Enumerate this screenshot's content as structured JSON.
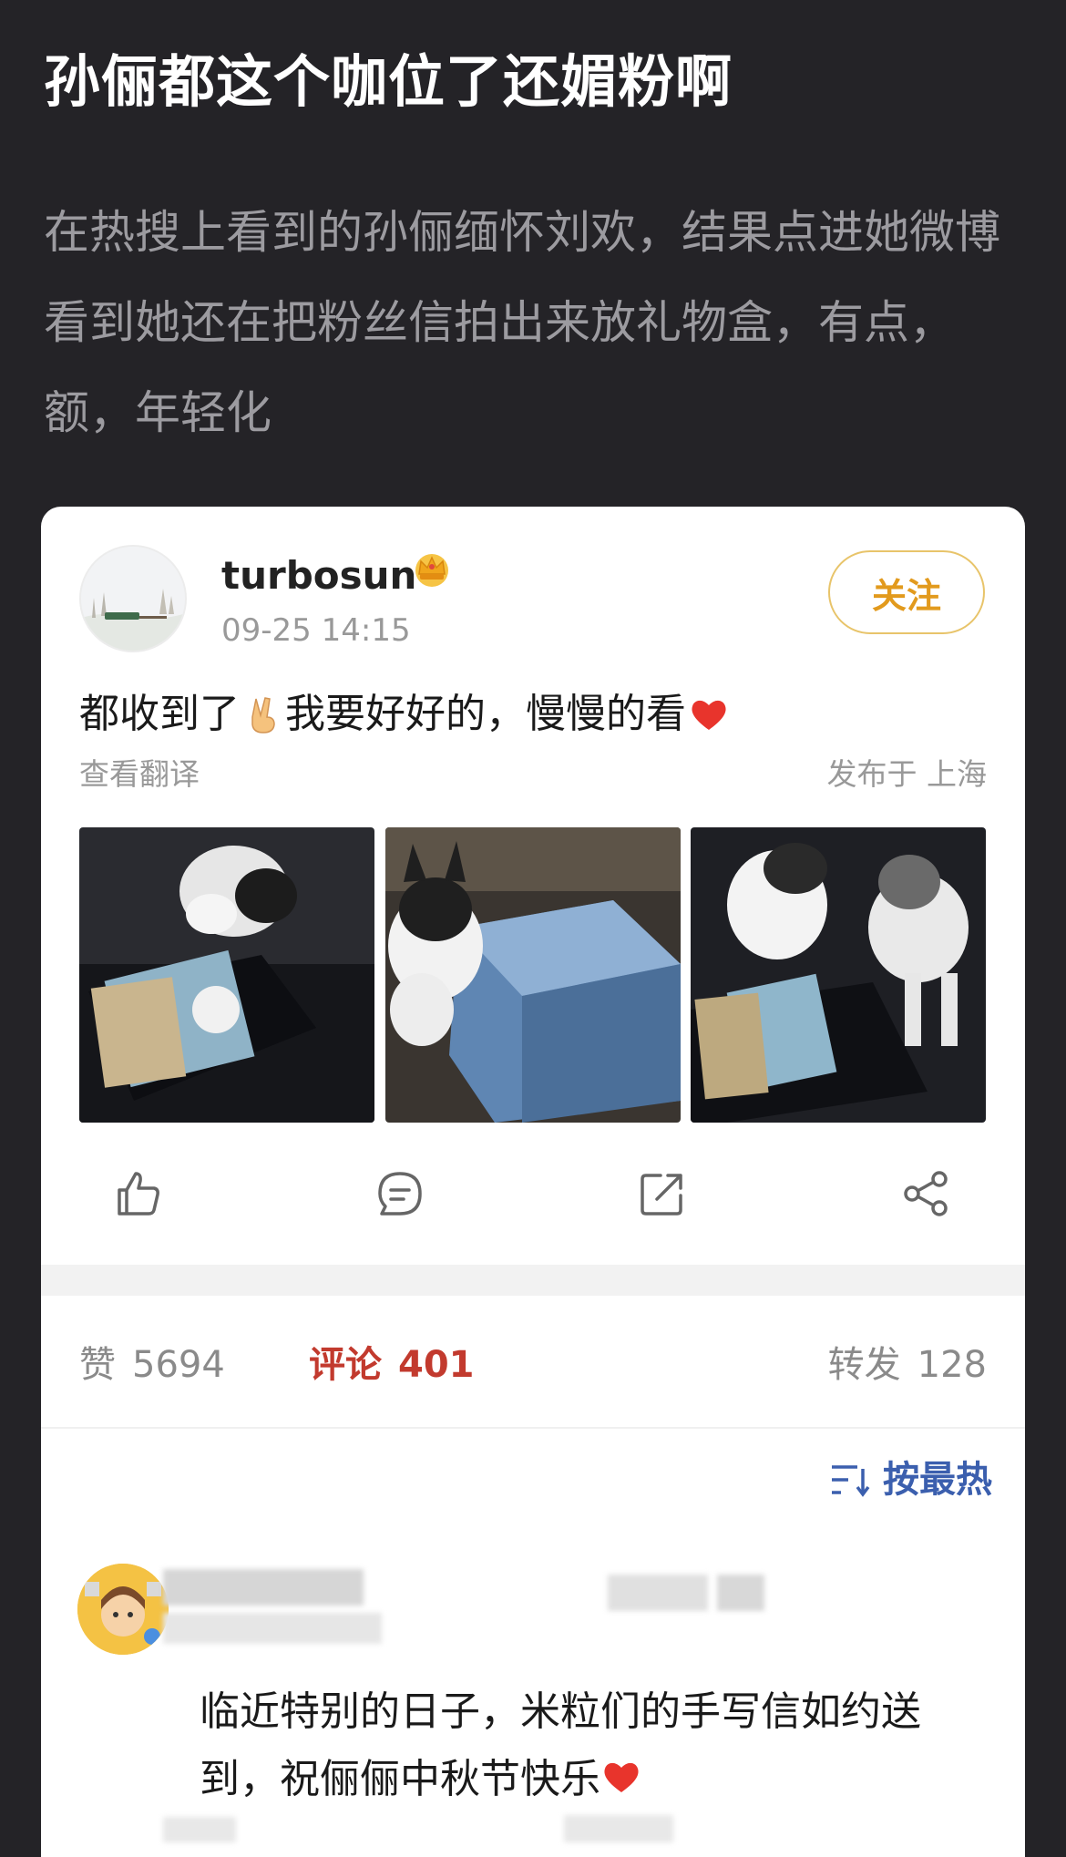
{
  "post": {
    "title": "孙俪都这个咖位了还媚粉啊",
    "description": "在热搜上看到的孙俪缅怀刘欢，结果点进她微博看到她还在把粉丝信拍出来放礼物盒，有点，额，年轻化"
  },
  "weibo": {
    "username": "turbosun",
    "badge_icon": "crown-icon",
    "time": "09-25 14:15",
    "follow_label": "关注",
    "text_part1": "都收到了",
    "text_part2": "我要好好的，慢慢的看",
    "emoji_1": "victory-hand-icon",
    "emoji_2": "red-heart-icon",
    "translate_label": "查看翻译",
    "location": "发布于 上海",
    "photos": [
      "cat-with-letters-photo",
      "cat-and-gift-box-photo",
      "two-cats-with-box-photo"
    ],
    "actions": [
      "like-icon",
      "comment-icon",
      "repost-icon",
      "share-icon"
    ]
  },
  "stats": {
    "like_label": "赞",
    "like_count": "5694",
    "comment_label": "评论",
    "comment_count": "401",
    "repost_label": "转发",
    "repost_count": "128"
  },
  "sort": {
    "label": "按最热"
  },
  "comment": {
    "text_line": "临近特别的日子，米粒们的手写信如约送到，祝俪俪中秋节快乐",
    "emoji": "red-heart-icon"
  },
  "colors": {
    "background": "#242327",
    "card": "#ffffff",
    "accent_comment": "#c23a2e",
    "follow": "#e29a1d",
    "sort": "#3b5fae"
  }
}
